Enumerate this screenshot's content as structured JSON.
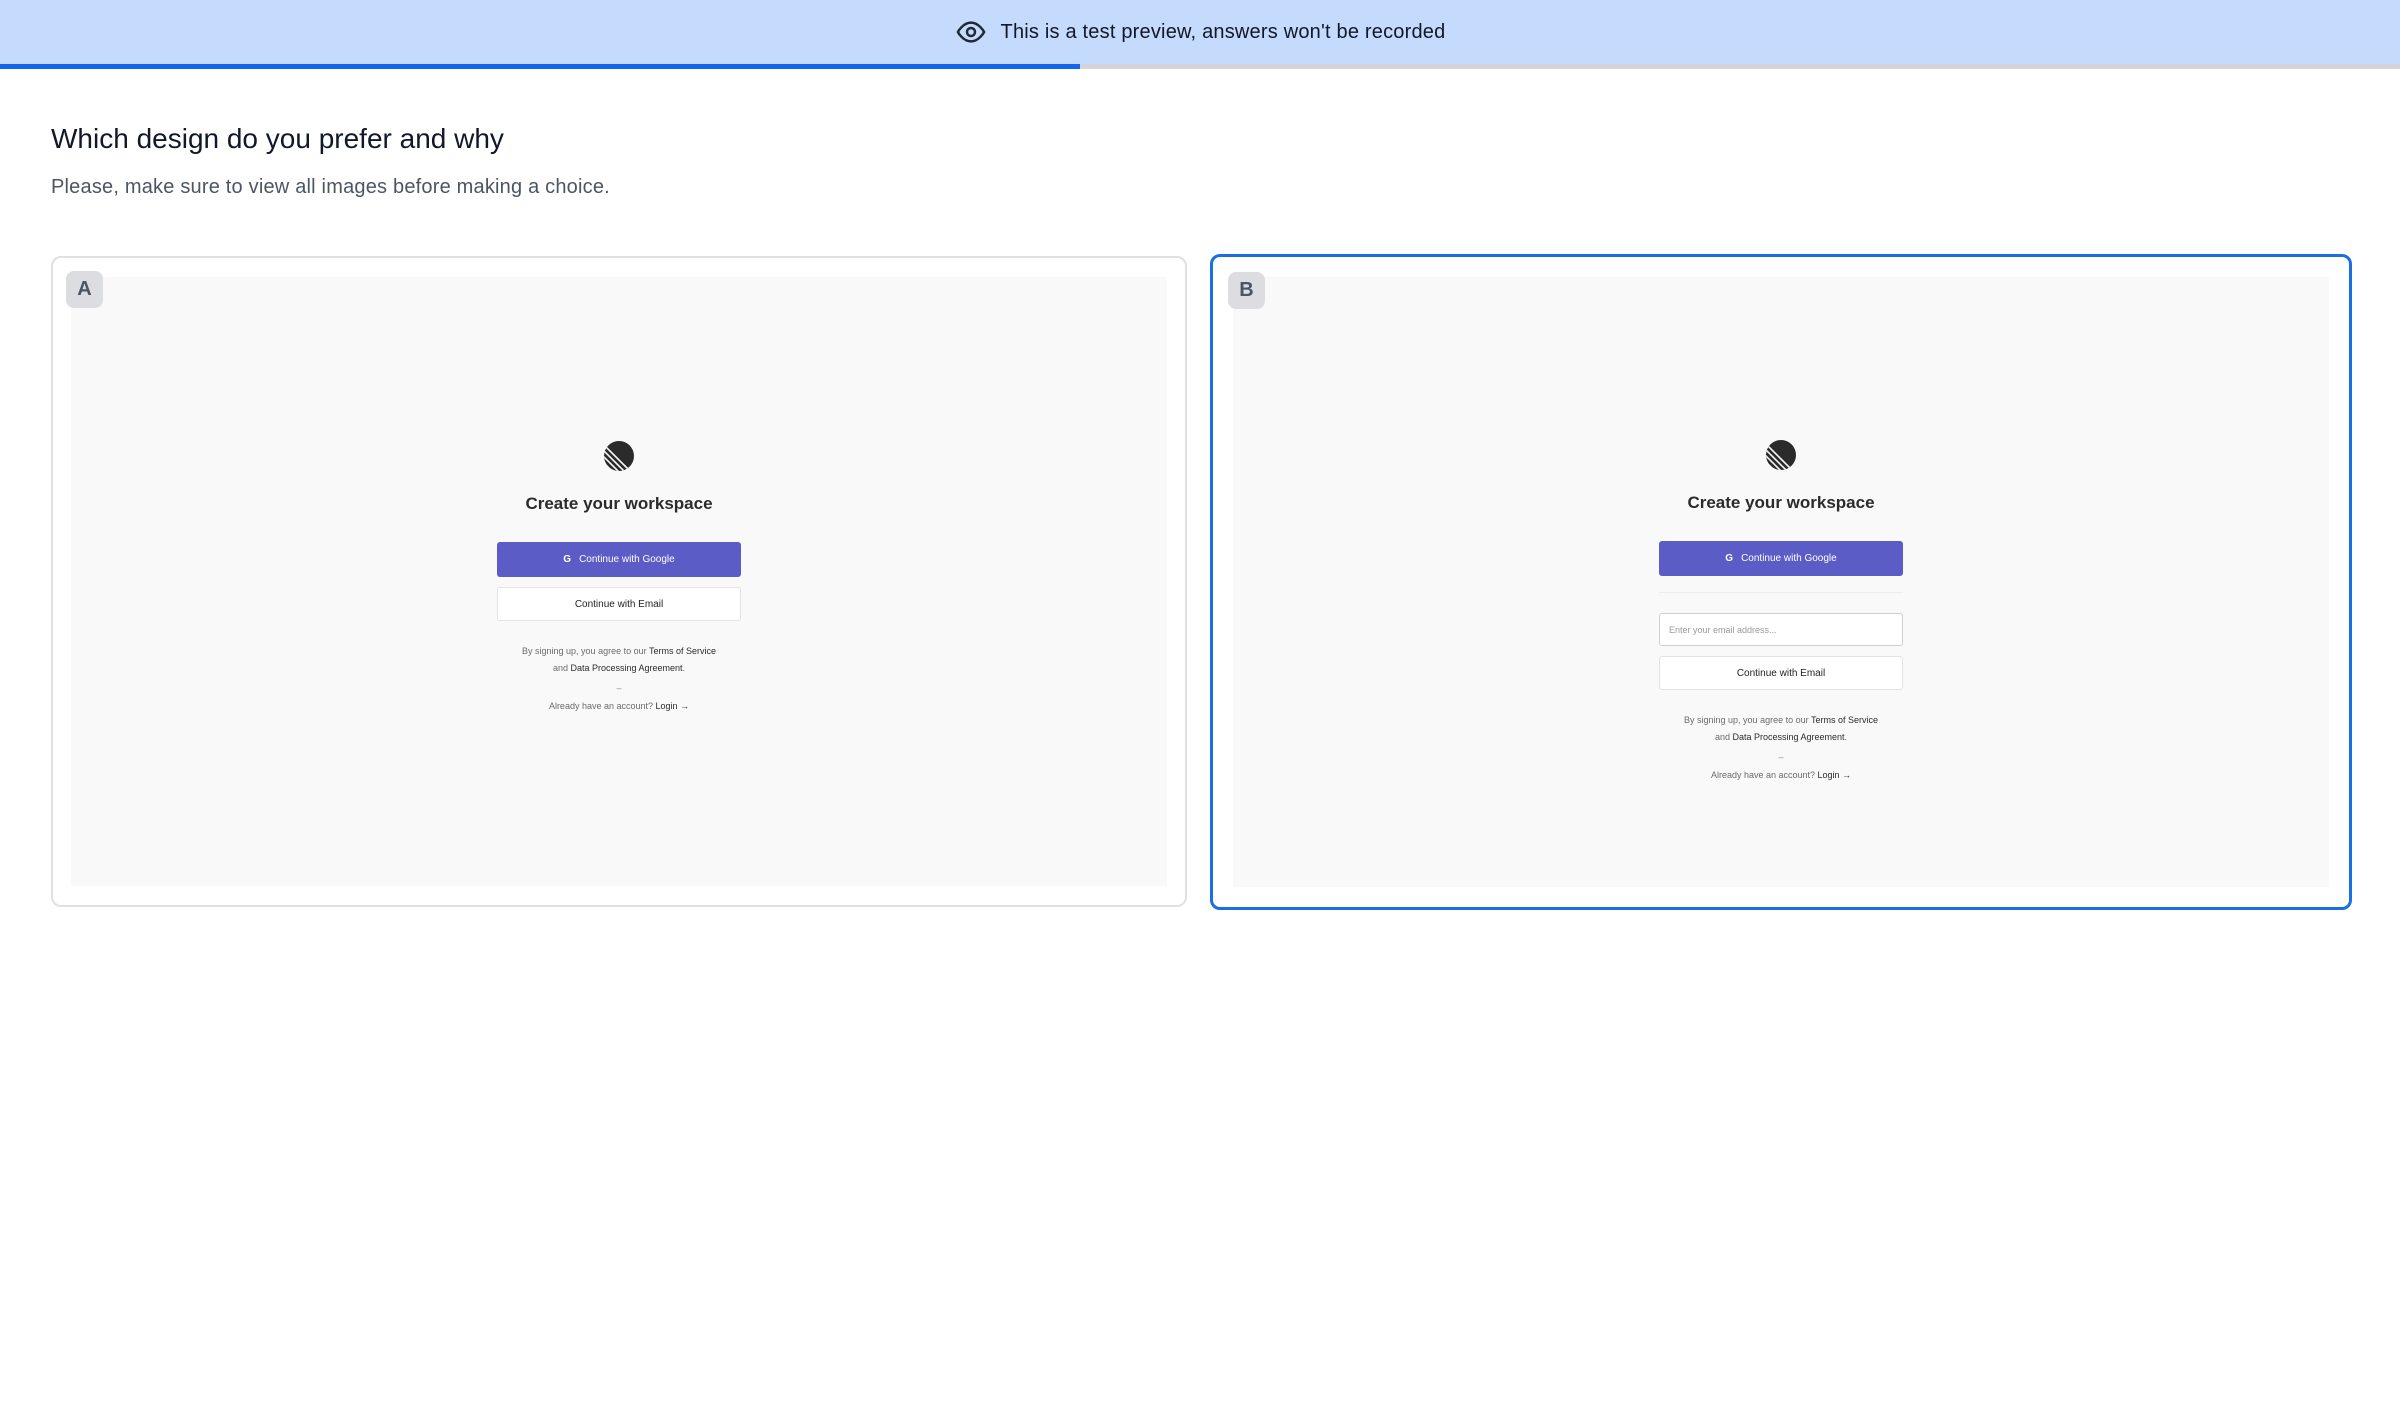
{
  "banner": {
    "text": "This is a test preview, answers won't be recorded",
    "icon": "eye-icon",
    "background": "#c4dbfd"
  },
  "progress": {
    "fraction": 0.45,
    "color": "#1267ee"
  },
  "question": {
    "title": "Which design do you prefer and why",
    "subtitle": "Please, make sure to view all images before making a choice."
  },
  "options": [
    {
      "badge": "A",
      "selected": false,
      "mock": {
        "title": "Create your workspace",
        "google_button": "Continue with Google",
        "email_button": "Continue with Email",
        "terms_prefix": "By signing up, you agree to our",
        "terms_link": "Terms of Service",
        "terms_and": "and",
        "dpa_link": "Data Processing Agreement",
        "dash": "–",
        "login_prefix": "Already have an account?",
        "login_link": "Login →"
      }
    },
    {
      "badge": "B",
      "selected": true,
      "mock": {
        "title": "Create your workspace",
        "google_button": "Continue with Google",
        "email_placeholder": "Enter your email address...",
        "email_button": "Continue with Email",
        "terms_prefix": "By signing up, you agree to our",
        "terms_link": "Terms of Service",
        "terms_and": "and",
        "dpa_link": "Data Processing Agreement",
        "dash": "–",
        "login_prefix": "Already have an account?",
        "login_link": "Login →"
      }
    }
  ],
  "colors": {
    "accent": "#1a6fe5",
    "mock_button": "#5c5cc6"
  }
}
